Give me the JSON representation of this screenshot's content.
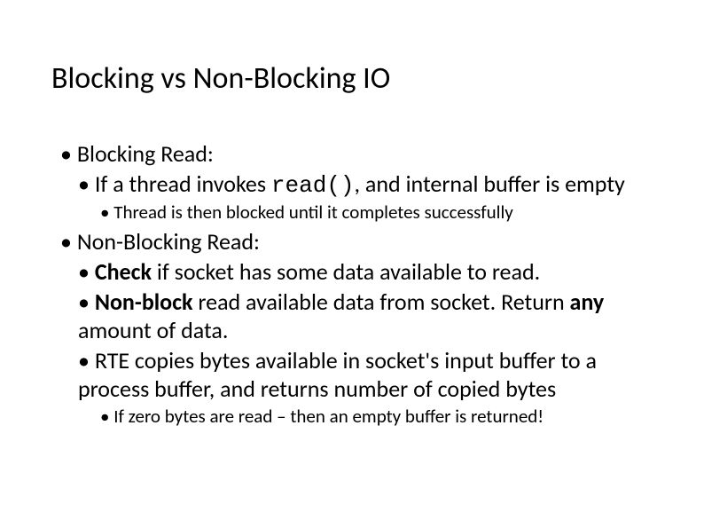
{
  "title": "Blocking vs Non-Blocking IO",
  "items": {
    "blockingRead": "Blocking Read:",
    "ifThread_pre": "If a thread invokes ",
    "ifThread_code": "read()",
    "ifThread_post": ", and internal buffer is empty",
    "threadBlocked": "Thread is then blocked until it completes successfully",
    "nonBlockingRead": "Non-Blocking Read:",
    "check_bold": "Check",
    "check_rest": " if socket has some data available to read.",
    "nonblock_bold1": "Non-block",
    "nonblock_mid": " read available data from socket. Return ",
    "nonblock_bold2": "any",
    "nonblock_rest": " amount of data.",
    "rte": "RTE copies bytes available in socket's input buffer to a process buffer, and returns number of copied bytes",
    "zero": "If zero bytes are read – then an empty buffer is returned!"
  }
}
